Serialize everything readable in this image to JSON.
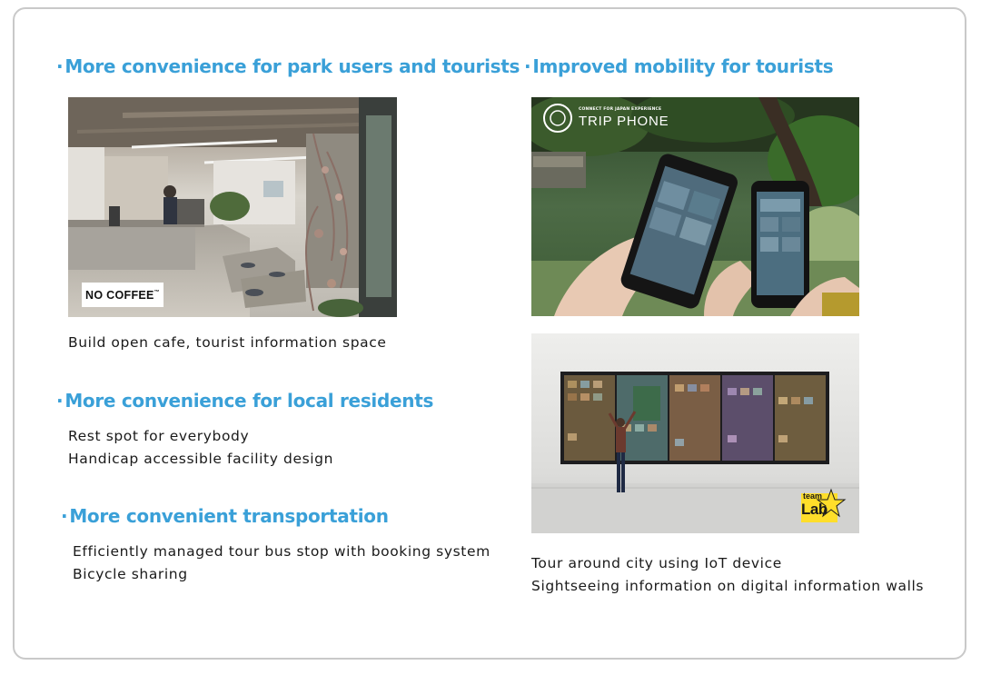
{
  "left": {
    "section1": {
      "heading": "More convenience for park users and tourists",
      "photo_label": "NO COFFEE",
      "photo_label_mark": "™",
      "caption": "Build open cafe, tourist information space"
    },
    "section2": {
      "heading": "More convenience for local residents",
      "lines": [
        "Rest spot for everybody",
        "Handicap accessible facility design"
      ]
    },
    "section3": {
      "heading": "More convenient transportation",
      "lines": [
        "Efficiently managed tour bus stop with booking system",
        "Bicycle sharing"
      ]
    }
  },
  "right": {
    "section1": {
      "heading": "Improved mobility for tourists",
      "photo1_brand_small": "CONNECT FOR JAPAN EXPERIENCE",
      "photo1_brand": "TRIP PHONE",
      "photo2_logo_top": "team",
      "photo2_logo_bottom": "Lab",
      "lines": [
        "Tour around city using IoT device",
        "Sightseeing information on digital information walls"
      ]
    }
  },
  "bullet": "·",
  "colors": {
    "accent": "#3aa0d8",
    "border": "#c9c9c9",
    "text": "#1a1a1a"
  }
}
